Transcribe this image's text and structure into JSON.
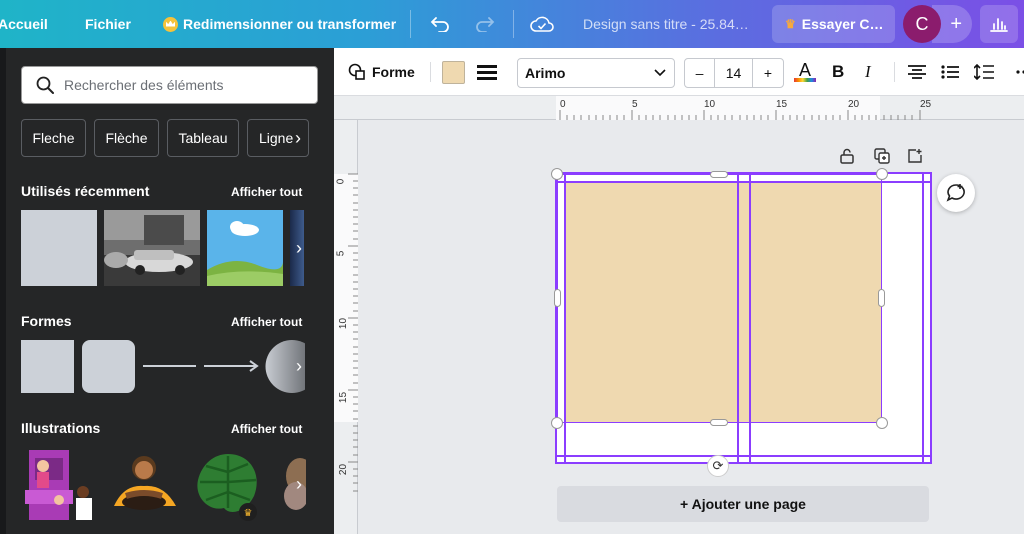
{
  "topbar": {
    "home_label": "Accueil",
    "file_label": "Fichier",
    "resize_label": "Redimensionner ou transformer",
    "design_title": "Design sans titre - 25.84…",
    "try_label": "Essayer C…",
    "avatar_initial": "C",
    "add_symbol": "+"
  },
  "panel": {
    "search_placeholder": "Rechercher des éléments",
    "chips": [
      "Fleche",
      "Flèche",
      "Tableau",
      "Ligne"
    ],
    "recent": {
      "title": "Utilisés récemment",
      "link": "Afficher tout"
    },
    "shapes": {
      "title": "Formes",
      "link": "Afficher tout"
    },
    "illustrations": {
      "title": "Illustrations",
      "link": "Afficher tout"
    }
  },
  "toolbar": {
    "shape_label": "Forme",
    "fill_color": "#efd9b0",
    "font_name": "Arimo",
    "font_size": "14",
    "minus": "–",
    "plus": "+",
    "color_letter": "A",
    "bold": "B",
    "italic": "I"
  },
  "ruler": {
    "top_labels": [
      "0",
      "5",
      "10",
      "15",
      "20",
      "25"
    ],
    "left_labels": [
      "0",
      "5",
      "10",
      "15",
      "20"
    ]
  },
  "canvas": {
    "add_page_label": "+ Ajouter une page",
    "accent_color": "#8b3dff"
  }
}
